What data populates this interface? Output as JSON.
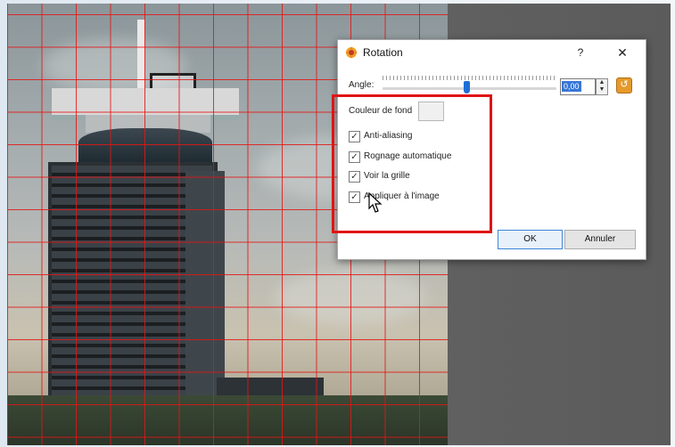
{
  "dialog": {
    "title": "Rotation",
    "help_label": "?",
    "close_label": "✕",
    "angle_label": "Angle:",
    "angle_value": "0,00",
    "background_color_label": "Couleur de fond",
    "options": [
      {
        "label": "Anti-aliasing",
        "checked": true
      },
      {
        "label": "Rognage automatique",
        "checked": true
      },
      {
        "label": "Voir la grille",
        "checked": true
      },
      {
        "label": "Appliquer à l'image",
        "checked": true
      }
    ],
    "ok_label": "OK",
    "cancel_label": "Annuler",
    "slider_level": 0.5
  },
  "colors": {
    "grid": "#e61414",
    "highlight": "#e01414",
    "accent": "#1e6fd4",
    "reset_button": "#e59a2a"
  },
  "icons": {
    "title": "rotation-app-icon",
    "reset": "reset-circle-arrow-icon",
    "cursor": "mouse-pointer-icon"
  }
}
